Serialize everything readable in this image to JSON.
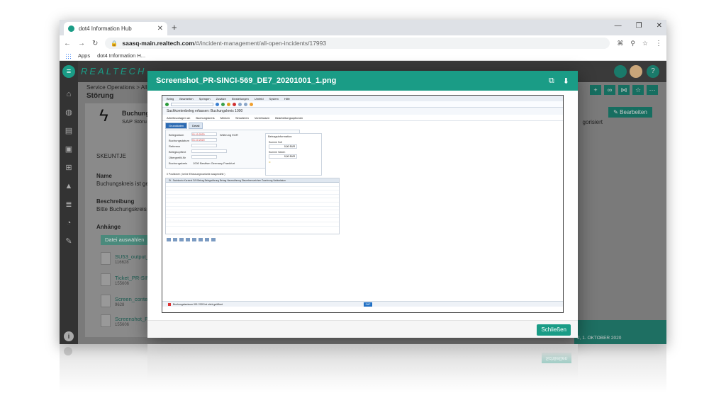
{
  "browser": {
    "tab_title": "dot4 Information Hub",
    "url_host": "saasq-main.realtech.com",
    "url_path": "/#/incident-management/all-open-incidents/17993",
    "bookmarks": [
      "Apps",
      "dot4 Information H..."
    ]
  },
  "app": {
    "logo_text": "REALTECH",
    "breadcrumb": "Service Operations > All",
    "page_title": "Störung",
    "card_title": "Buchung",
    "card_sub": "SAP Störu",
    "field_code": "SKEUNTJE",
    "labels": {
      "name": "Name",
      "name_value": "Buchungskreis ist ge",
      "desc": "Beschreibung",
      "desc_value": "Bitte Buchungskreis",
      "attachments": "Anhänge"
    },
    "datei_button": "Datei auswählen",
    "attachments": [
      {
        "name": "SU53_output_",
        "size": "116628"
      },
      {
        "name": "Ticket_PR-SIN",
        "size": "155606"
      },
      {
        "name": "Screen_conte",
        "size": "9628"
      },
      {
        "name": "Screenshot_P",
        "size": "155606"
      }
    ],
    "edit_button": "Bearbeiten",
    "status_partial": "gorisiert",
    "footer_date": "2, 1. OKTOBER 2020",
    "badge_count": "2"
  },
  "modal": {
    "title": "Screenshot_PR-SINCI-569_DE7_20201001_1.png",
    "close_button": "Schließen",
    "icons": [
      "external-link-icon",
      "download-icon"
    ]
  },
  "sap": {
    "menu": [
      "Beleg",
      "Bearbeiten",
      "Springen",
      "Zusätze",
      "Einstellungen",
      "Umfeld",
      "System",
      "Hilfe"
    ],
    "screen_title": "Sachkontenbeleg erfassen: Buchungskreis 1000",
    "actions": [
      "Arbeitsvorlagen an",
      "Buchungskreis",
      "Merken",
      "Simulieren",
      "Vorerfassen",
      "Bearbeitungsoptionen"
    ],
    "tabs": [
      "Grunddaten",
      "Detail"
    ],
    "form": [
      {
        "label": "Belegdatum",
        "value": "01.10.2020"
      },
      {
        "label": "Buchungsdatum",
        "value": "01.10.2020"
      },
      {
        "label": "Referenz",
        "value": ""
      },
      {
        "label": "Belegkopftext",
        "value": ""
      },
      {
        "label": "Übergreifd.Nr",
        "value": ""
      },
      {
        "label": "Buchungskreis",
        "value": "1000 Bestfsm Germany Frankfurt"
      }
    ],
    "currency_label": "Währung",
    "currency": "EUR",
    "info_title": "Betragsinformation",
    "soll_label": "Summe Soll",
    "soll_value": "0,00 EUR",
    "haben_label": "Summe Haben",
    "haben_value": "0,00 EUR",
    "grid_caption": "0 Positionen ( keine Erfassungsvariante ausgewählt )",
    "grid_header": "St.. Sachkonto  Kurztext  S/H  Betrag Belegwährung  Betrag Hauswährung  Steuerkennzeichen  Zuordnung  Valutadatum",
    "status_text": "Buchungsbreisum 001 2020 ist nicht geöffnet",
    "sap_logo": "SAP"
  }
}
